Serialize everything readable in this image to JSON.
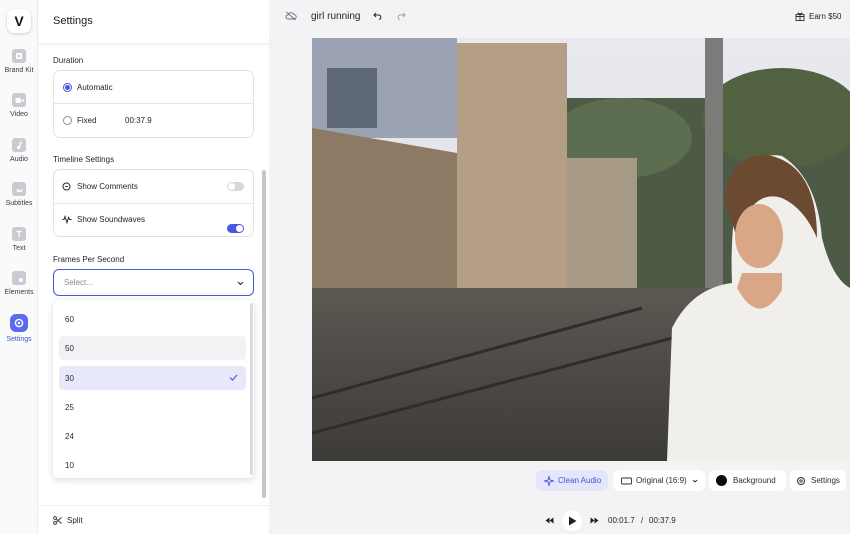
{
  "rail": {
    "logo": "V",
    "items": [
      {
        "label": "Brand Kit",
        "icon": "brand-kit-icon"
      },
      {
        "label": "Video",
        "icon": "video-icon"
      },
      {
        "label": "Audio",
        "icon": "audio-icon"
      },
      {
        "label": "Subtitles",
        "icon": "subtitles-icon"
      },
      {
        "label": "Text",
        "icon": "text-icon"
      },
      {
        "label": "Elements",
        "icon": "elements-icon"
      },
      {
        "label": "Settings",
        "icon": "settings-icon",
        "active": true
      }
    ]
  },
  "panel": {
    "title": "Settings",
    "duration": {
      "heading": "Duration",
      "automatic_label": "Automatic",
      "fixed_label": "Fixed",
      "fixed_value": "00:37.9",
      "selected": "Automatic"
    },
    "timeline": {
      "heading": "Timeline Settings",
      "show_comments_label": "Show Comments",
      "show_comments_on": false,
      "show_soundwaves_label": "Show Soundwaves",
      "show_soundwaves_on": true
    },
    "fps": {
      "heading": "Frames Per Second",
      "placeholder": "Select...",
      "options": [
        "60",
        "50",
        "30",
        "25",
        "24",
        "10"
      ],
      "hovered": "50",
      "selected": "30"
    },
    "split_label": "Split"
  },
  "topbar": {
    "project_name": "girl running",
    "earn_label": "Earn $50"
  },
  "controls": {
    "clean_audio_label": "Clean Audio",
    "aspect_label": "Original (16:9)",
    "background_label": "Background",
    "settings_label": "Settings"
  },
  "playback": {
    "current_time": "00:01.7",
    "separator": "/",
    "total_time": "00:37.9"
  },
  "colors": {
    "accent": "#4a57e0",
    "clean_audio_bg": "#e4e7fb"
  }
}
